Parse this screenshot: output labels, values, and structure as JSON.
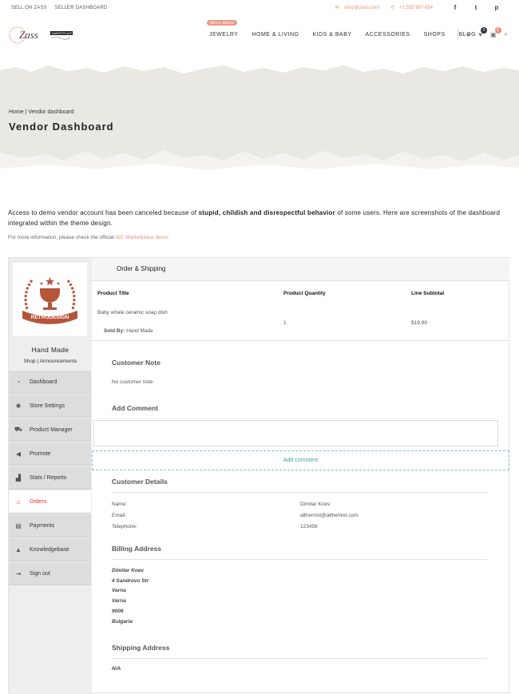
{
  "topbar": {
    "sell": "SELL ON ZASS",
    "seller_dashboard": "SELLER DASHBOARD",
    "email": "shop@zass.com",
    "phone": "+1 555 987 654",
    "social": [
      "f",
      "t",
      "p"
    ]
  },
  "logo": {
    "text": "Zass",
    "tag": "MARKETPLACE"
  },
  "nav": {
    "badge": "MEGA MENU",
    "items": [
      "JEWELRY",
      "HOME & LIVING",
      "KIDS & BABY",
      "ACCESSORIES",
      "SHOPS",
      "BLOG"
    ],
    "wishlist_count": "0",
    "cart_count": "0"
  },
  "hero": {
    "breadcrumb_home": "Home",
    "breadcrumb_current": "Vendor dashboard",
    "title": "Vendor Dashboard"
  },
  "notice": {
    "before": "Access to demo vendor account has been canceled because of ",
    "bold": "stupid,  childish and disrespectful behavior",
    "after": " of some users. Here are screenshots of the dashboard integrated within the theme design.",
    "more_before": "For more information, please check the official ",
    "more_link": "WC Marketplace demo"
  },
  "sidebar": {
    "shop_name": "Hand Made",
    "shop_link": "Shop",
    "announcements_link": "Announcements",
    "logo_text": "RETRODESIGN",
    "items": [
      {
        "label": "Dashboard",
        "icon": "gauge-icon"
      },
      {
        "label": "Store Settings",
        "icon": "gear-icon"
      },
      {
        "label": "Product Manager",
        "icon": "cart-icon"
      },
      {
        "label": "Promote",
        "icon": "megaphone-icon"
      },
      {
        "label": "Stats / Reports",
        "icon": "bar-chart-icon"
      },
      {
        "label": "Orders",
        "icon": "store-icon"
      },
      {
        "label": "Payments",
        "icon": "money-icon"
      },
      {
        "label": "Knowledgebase",
        "icon": "graduation-cap-icon"
      },
      {
        "label": "Sign out",
        "icon": "sign-out-icon"
      }
    ],
    "active_color": "#e33333"
  },
  "order": {
    "heading": "Order & Shipping",
    "headers": [
      "Product Title",
      "Product Quantity",
      "Line Subtotal"
    ],
    "product": "Baby whale ceramic soap dish",
    "sold_by_label": "Sold By:",
    "sold_by": "Hand Made",
    "quantity": "1",
    "subtotal": "$19.99",
    "customer_note_title": "Customer Note",
    "customer_note": "No customer note.",
    "add_comment_title": "Add Comment",
    "add_comment_button": "Add comment",
    "customer_details_title": "Customer Details",
    "details": [
      {
        "label": "Name:",
        "value": "Dimitar Koev"
      },
      {
        "label": "Email:",
        "value": "althemist@althemist.com"
      },
      {
        "label": "Telephone:",
        "value": "123456"
      }
    ],
    "billing_title": "Billing Address",
    "billing": [
      "Dimitar Koev",
      "4 Sandrovo Str",
      "Varna",
      "Varna",
      "9006",
      "Bulgaria"
    ],
    "shipping_title": "Shipping Address",
    "shipping": "N/A"
  },
  "colors": {
    "accent": "#e8907b",
    "teal": "#3fa3a3",
    "hero_bg": "#eae8e3"
  }
}
